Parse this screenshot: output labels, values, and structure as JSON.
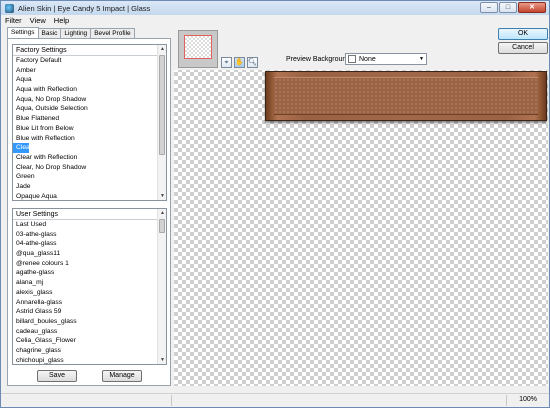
{
  "window": {
    "title": "Alien Skin | Eye Candy 5 Impact | Glass"
  },
  "menu": [
    "Filter",
    "View",
    "Help"
  ],
  "tabs": [
    "Settings",
    "Basic",
    "Lighting",
    "Bevel Profile"
  ],
  "factory": {
    "header": "Factory Settings",
    "items": [
      "Factory Default",
      "Amber",
      "Aqua",
      "Aqua with Reflection",
      "Aqua, No Drop Shadow",
      "Aqua, Outside Selection",
      "Blue Flattened",
      "Blue Lit from Below",
      "Blue with Reflection",
      "Clear",
      "Clear with Reflection",
      "Clear, No Drop Shadow",
      "Green",
      "Jade",
      "Opaque Aqua"
    ],
    "selected": "Clear"
  },
  "user": {
    "header": "User Settings",
    "items": [
      "Last Used",
      "03-athe-glass",
      "04-athe-glass",
      "@qua_glass11",
      "@renee colours 1",
      "agathe-glass",
      "alana_mj",
      "alexis_glass",
      "Annarella-glass",
      "Astrid Glass 59",
      "billard_boules_glass",
      "cadeau_glass",
      "Celia_Glass_Flower",
      "chagrine_glass",
      "chichoupi_glass"
    ]
  },
  "buttons": {
    "save": "Save",
    "manage": "Manage",
    "ok": "OK",
    "cancel": "Cancel"
  },
  "preview": {
    "background_label": "Preview Background:",
    "background_value": "None"
  },
  "status": {
    "zoom": "100%"
  },
  "colors": {
    "selection": "#3399ff",
    "glass": "#9a6345"
  }
}
